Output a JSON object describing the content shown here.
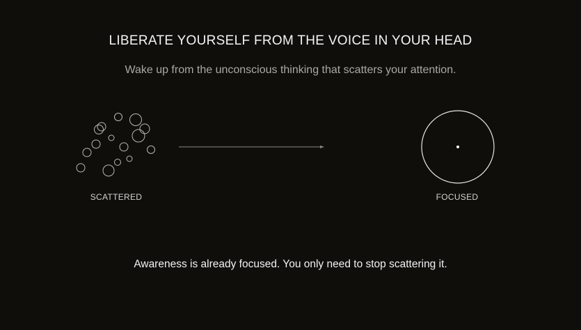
{
  "header": {
    "title": "LIBERATE YOURSELF FROM THE VOICE IN YOUR HEAD",
    "subtitle": "Wake up from the unconscious thinking that scatters your attention."
  },
  "diagram": {
    "left_label": "SCATTERED",
    "right_label": "FOCUSED"
  },
  "footer": {
    "closing": "Awareness is already focused. You only need to stop scattering it."
  },
  "colors": {
    "background": "#0f0e0b",
    "stroke": "#bfbfbc",
    "text_muted": "#a9a9a6"
  }
}
